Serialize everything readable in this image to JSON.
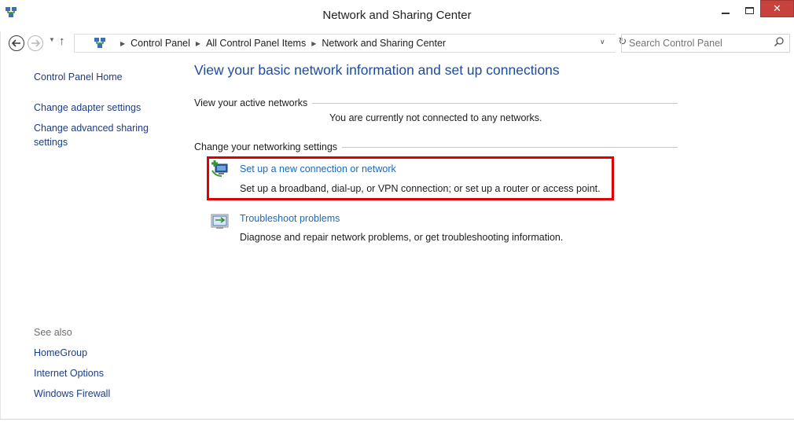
{
  "window": {
    "title": "Network and Sharing Center",
    "close_glyph": "✕"
  },
  "address_bar": {
    "breadcrumbs": [
      "Control Panel",
      "All Control Panel Items",
      "Network and Sharing Center"
    ],
    "search_placeholder": "Search Control Panel"
  },
  "sidebar": {
    "home": "Control Panel Home",
    "links": [
      "Change adapter settings",
      "Change advanced sharing",
      "settings"
    ],
    "see_also_label": "See also",
    "see_also": [
      "HomeGroup",
      "Internet Options",
      "Windows Firewall"
    ]
  },
  "main": {
    "title": "View your basic network information and set up connections",
    "active_networks": {
      "heading": "View your active networks",
      "status": "You are currently not connected to any networks."
    },
    "settings": {
      "heading": "Change your networking settings",
      "tasks": [
        {
          "link": "Set up a new connection or network",
          "description": "Set up a broadband, dial-up, or VPN connection; or set up a router or access point.",
          "icon": "new-connection-icon"
        },
        {
          "link": "Troubleshoot problems",
          "description": "Diagnose and repair network problems, or get troubleshooting information.",
          "icon": "troubleshoot-icon"
        }
      ]
    }
  },
  "colors": {
    "link": "#1d6ab8",
    "title": "#1e4b9b",
    "highlight": "#e00000",
    "close": "#c7423c"
  }
}
